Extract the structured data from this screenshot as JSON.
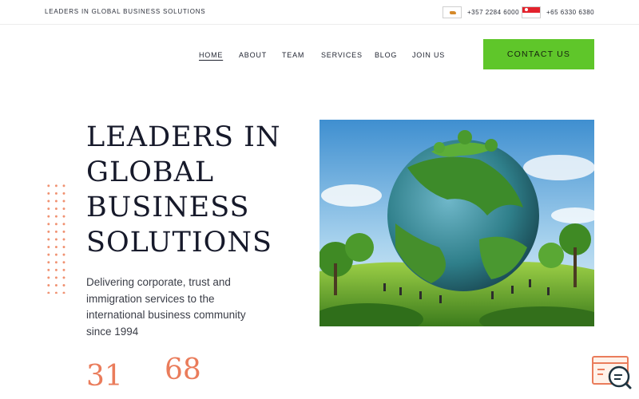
{
  "topbar": {
    "tagline": "LEADERS IN GLOBAL BUSINESS SOLUTIONS",
    "contacts": [
      {
        "flag": "cyprus-flag",
        "phone": "+357 2284 6000"
      },
      {
        "flag": "singapore-flag",
        "phone": "+65 6330 6380"
      }
    ]
  },
  "nav": {
    "items": [
      {
        "label": "HOME",
        "active": true
      },
      {
        "label": "ABOUT"
      },
      {
        "label": "TEAM"
      },
      {
        "label": "SERVICES"
      },
      {
        "label": "BLOG"
      },
      {
        "label": "JOIN US"
      }
    ],
    "cta_label": "CONTACT US"
  },
  "hero": {
    "headline_lines": [
      "LEADERS IN",
      "GLOBAL",
      "BUSINESS",
      "SOLUTIONS"
    ],
    "subtext": "Delivering corporate, trust and immigration services to the international business community since 1994",
    "stats": [
      "31",
      "68"
    ],
    "image": "green-globe-illustration"
  },
  "colors": {
    "accent_green": "#5fc62a",
    "accent_coral": "#ea7c5b",
    "text_dark": "#16192a"
  },
  "widget": {
    "icon": "chat-search-icon"
  }
}
